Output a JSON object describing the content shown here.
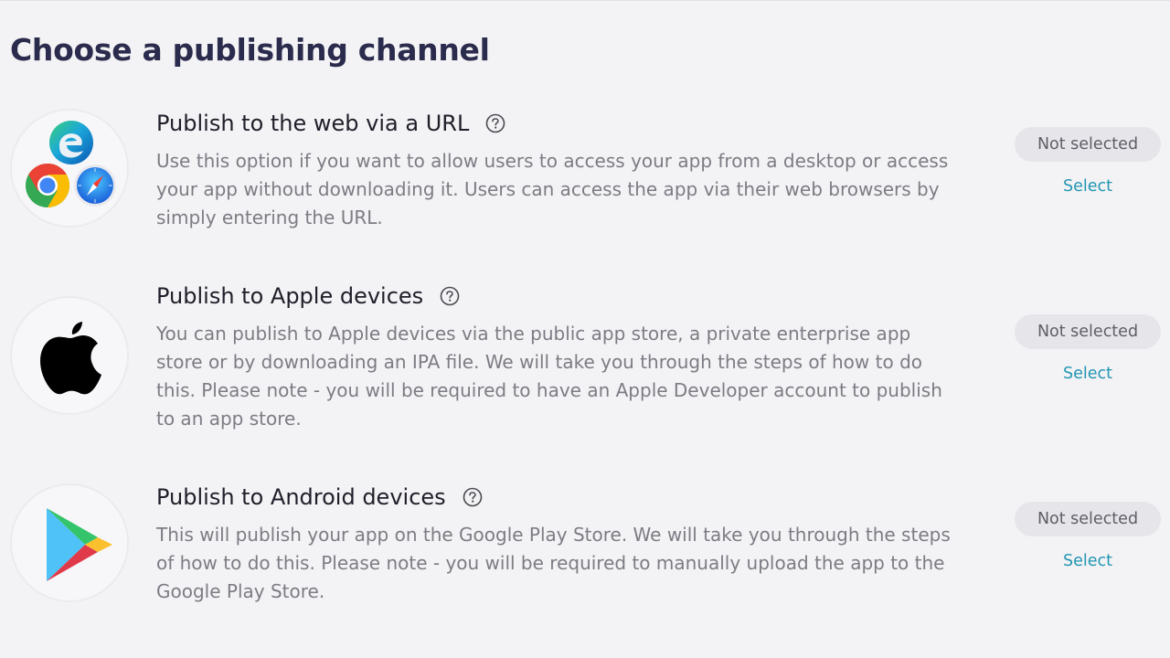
{
  "page": {
    "title": "Choose a publishing channel"
  },
  "channels": [
    {
      "title": "Publish to the web via a URL",
      "description": "Use this option if you want to allow users to access your app from a desktop or access your app without downloading it. Users can access the app via their web browsers by simply entering the URL.",
      "status": "Not selected",
      "action": "Select",
      "icons": [
        "edge-icon",
        "chrome-icon",
        "safari-icon"
      ]
    },
    {
      "title": "Publish to Apple devices",
      "description": "You can publish to Apple devices via the public app store, a private enterprise app store or by downloading an IPA file. We will take you through the steps of how to do this. Please note - you will be required to have an Apple Developer account to publish to an app store.",
      "status": "Not selected",
      "action": "Select",
      "icons": [
        "apple-icon"
      ]
    },
    {
      "title": "Publish to Android devices",
      "description": "This will publish your app on the Google Play Store. We will take you through the steps of how to do this. Please note - you will be required to manually upload the app to the Google Play Store.",
      "status": "Not selected",
      "action": "Select",
      "icons": [
        "google-play-icon"
      ]
    }
  ],
  "colors": {
    "background": "#f3f2f4",
    "title": "#2b2b4d",
    "description": "#7c7c84",
    "select_link": "#2196b3",
    "badge_bg": "#e6e5ea"
  }
}
